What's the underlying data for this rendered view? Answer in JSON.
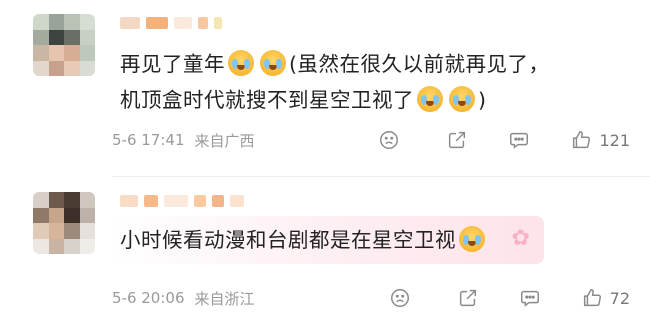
{
  "comments": [
    {
      "lines": [
        {
          "parts": [
            "再见了童年",
            "",
            "",
            "(虽然在很久以前就再见了，"
          ]
        },
        {
          "parts": [
            "机顶盒时代就搜不到星空卫视了",
            "",
            "",
            ")"
          ]
        }
      ],
      "time": "5-6 17:41",
      "location": "来自广西",
      "likes": "121"
    },
    {
      "lines": [
        {
          "parts": [
            "小时候看动漫和台剧都是在星空卫视",
            ""
          ]
        }
      ],
      "time": "5-6 20:06",
      "location": "来自浙江",
      "likes": "72"
    }
  ],
  "icons": {
    "emoji": "crying-face-icon",
    "dislike": "sad-face-icon",
    "share": "share-icon",
    "reply": "comment-bubble-icon",
    "like": "thumbs-up-icon",
    "decor": "paw-print-icon"
  },
  "colors": {
    "meta_text": "#9a9a9a",
    "highlight_bg": "#fde3ea",
    "icon": "#8a8a8a"
  }
}
